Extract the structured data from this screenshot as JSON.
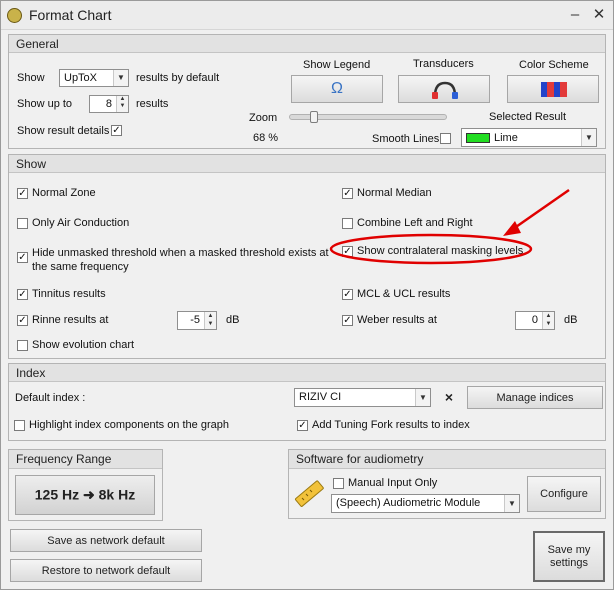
{
  "window": {
    "title": "Format Chart",
    "minimize": "–",
    "close": "✕"
  },
  "general": {
    "header": "General",
    "show_label": "Show",
    "show_value": "UpToX",
    "show_suffix": "results by default",
    "showupto_label": "Show up to",
    "showupto_value": "8",
    "showupto_suffix": "results",
    "show_details_label": "Show result details",
    "show_details_checked": true,
    "show_legend_label": "Show Legend",
    "transducers_label": "Transducers",
    "color_scheme_label": "Color Scheme",
    "zoom_label": "Zoom",
    "zoom_value": "68 %",
    "zoom_fraction": 0.68,
    "smooth_lines_label": "Smooth Lines",
    "smooth_lines_checked": false,
    "selected_result_label": "Selected Result",
    "selected_result_value": "Lime",
    "selected_result_color": "#22dd22"
  },
  "show": {
    "header": "Show",
    "normal_zone": "Normal Zone",
    "normal_median": "Normal Median",
    "only_air": "Only Air Conduction",
    "combine_lr": "Combine Left and Right",
    "hide_unmasked": "Hide unmasked threshold when a masked threshold exists at the same frequency",
    "contralateral": "Show contralateral masking levels",
    "tinnitus": "Tinnitus results",
    "mcl_ucl": "MCL & UCL results",
    "rinne": "Rinne results at",
    "rinne_value": "-5",
    "rinne_unit": "dB",
    "weber": "Weber results at",
    "weber_value": "0",
    "weber_unit": "dB",
    "evolution": "Show evolution chart"
  },
  "index": {
    "header": "Index",
    "default_label": "Default index :",
    "default_value": "RIZIV CI",
    "manage_label": "Manage indices",
    "highlight_label": "Highlight index components on the graph",
    "add_tuning_label": "Add Tuning Fork results to index"
  },
  "frequency": {
    "header": "Frequency Range",
    "range_from": "125 Hz",
    "range_to": "8k Hz"
  },
  "software": {
    "header": "Software for audiometry",
    "manual_input_label": "Manual Input Only",
    "module_value": "(Speech) Audiometric Module",
    "configure_label": "Configure"
  },
  "footer": {
    "save_network": "Save as network default",
    "restore_network": "Restore to network default",
    "save_settings": "Save my settings"
  },
  "colors": {
    "annotation": "#e00000",
    "lime": "#22dd22"
  }
}
